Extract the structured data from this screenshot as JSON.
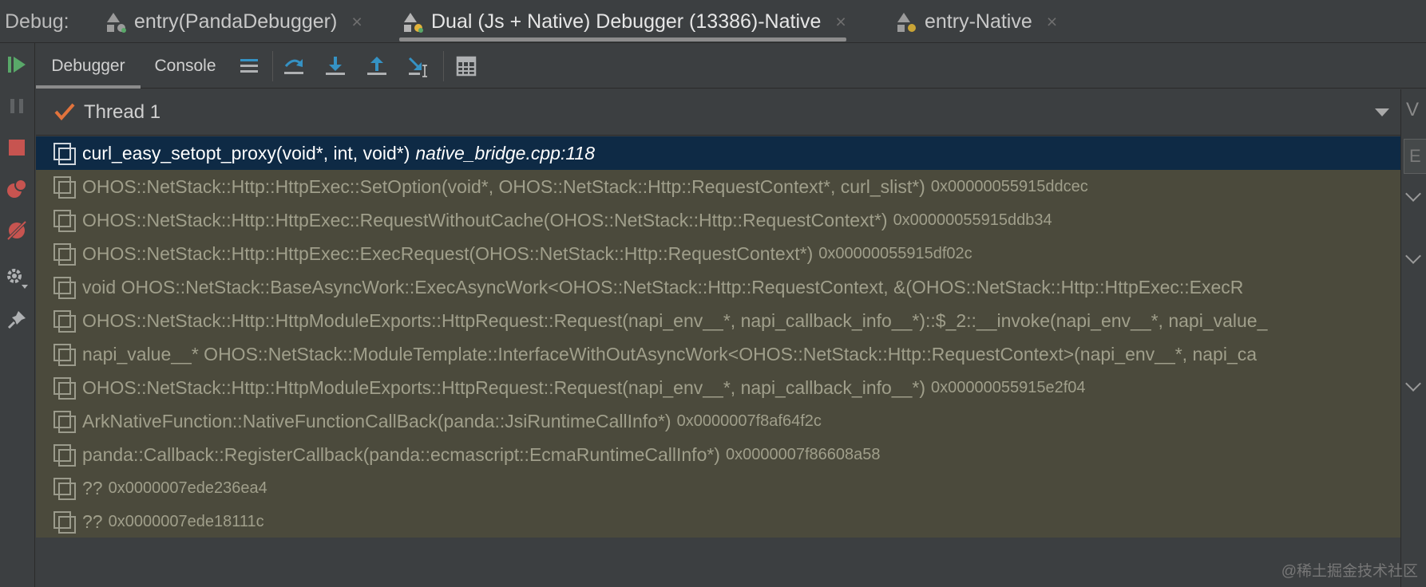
{
  "tabbar": {
    "label": "Debug:",
    "tabs": [
      {
        "label": "entry(PandaDebugger)",
        "close": "×"
      },
      {
        "label": "Dual (Js + Native) Debugger (13386)-Native",
        "close": "×"
      },
      {
        "label": "entry-Native",
        "close": "×"
      }
    ]
  },
  "toolbar": {
    "tabs": [
      {
        "label": "Debugger"
      },
      {
        "label": "Console"
      }
    ]
  },
  "thread": {
    "name": "Thread 1"
  },
  "frames": [
    {
      "func": "curl_easy_setopt_proxy(void*, int, void*)",
      "location": "native_bridge.cpp:118",
      "addr": ""
    },
    {
      "func": "OHOS::NetStack::Http::HttpExec::SetOption(void*, OHOS::NetStack::Http::RequestContext*, curl_slist*)",
      "addr": "0x00000055915ddcec"
    },
    {
      "func": "OHOS::NetStack::Http::HttpExec::RequestWithoutCache(OHOS::NetStack::Http::RequestContext*)",
      "addr": "0x00000055915ddb34"
    },
    {
      "func": "OHOS::NetStack::Http::HttpExec::ExecRequest(OHOS::NetStack::Http::RequestContext*)",
      "addr": "0x00000055915df02c"
    },
    {
      "func": "void OHOS::NetStack::BaseAsyncWork::ExecAsyncWork<OHOS::NetStack::Http::RequestContext, &(OHOS::NetStack::Http::HttpExec::ExecR",
      "addr": ""
    },
    {
      "func": "OHOS::NetStack::Http::HttpModuleExports::HttpRequest::Request(napi_env__*, napi_callback_info__*)::$_2::__invoke(napi_env__*, napi_value_",
      "addr": ""
    },
    {
      "func": "napi_value__* OHOS::NetStack::ModuleTemplate::InterfaceWithOutAsyncWork<OHOS::NetStack::Http::RequestContext>(napi_env__*, napi_ca",
      "addr": ""
    },
    {
      "func": "OHOS::NetStack::Http::HttpModuleExports::HttpRequest::Request(napi_env__*, napi_callback_info__*)",
      "addr": "0x00000055915e2f04"
    },
    {
      "func": "ArkNativeFunction::NativeFunctionCallBack(panda::JsiRuntimeCallInfo*)",
      "addr": "0x0000007f8af64f2c"
    },
    {
      "func": "panda::Callback::RegisterCallback(panda::ecmascript::EcmaRuntimeCallInfo*)",
      "addr": "0x0000007f86608a58"
    },
    {
      "func": "??",
      "addr": "0x0000007ede236ea4"
    },
    {
      "func": "??",
      "addr": "0x0000007ede18111c"
    }
  ],
  "right_panel": {
    "header_fragment": "V",
    "input_fragment": "E"
  },
  "watermark": "@稀土掘金技术社区",
  "colors": {
    "accent_green": "#59a869",
    "stop_red": "#c75450",
    "step_blue": "#3592c4",
    "selected_frame": "#0e2a45",
    "frames_bg": "#4b4a3c"
  }
}
